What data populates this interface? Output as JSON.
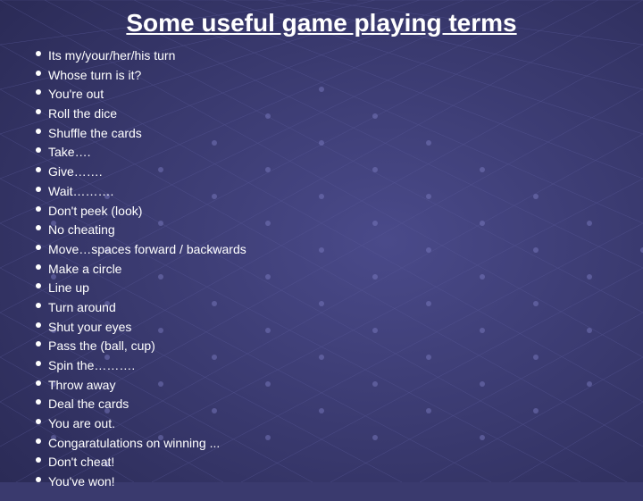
{
  "page": {
    "title": "Some useful game playing terms",
    "background_color": "#3a3a6e",
    "accent_color": "#ffffff"
  },
  "terms": [
    "Its my/your/her/his turn",
    "Whose turn is it?",
    "You're out",
    "Roll the dice",
    "Shuffle the cards",
    "Take….",
    "Give…….",
    "Wait……….",
    "Don't peek (look)",
    "No cheating",
    "Move…spaces forward / backwards",
    "Make a circle",
    "Line up",
    "Turn around",
    "Shut your eyes",
    "Pass the (ball, cup)",
    "Spin the……….",
    "Throw away",
    "Deal the cards",
    "You are out.",
    "Congaratulations on winning ...",
    "Don't cheat!",
    "You've won!"
  ]
}
